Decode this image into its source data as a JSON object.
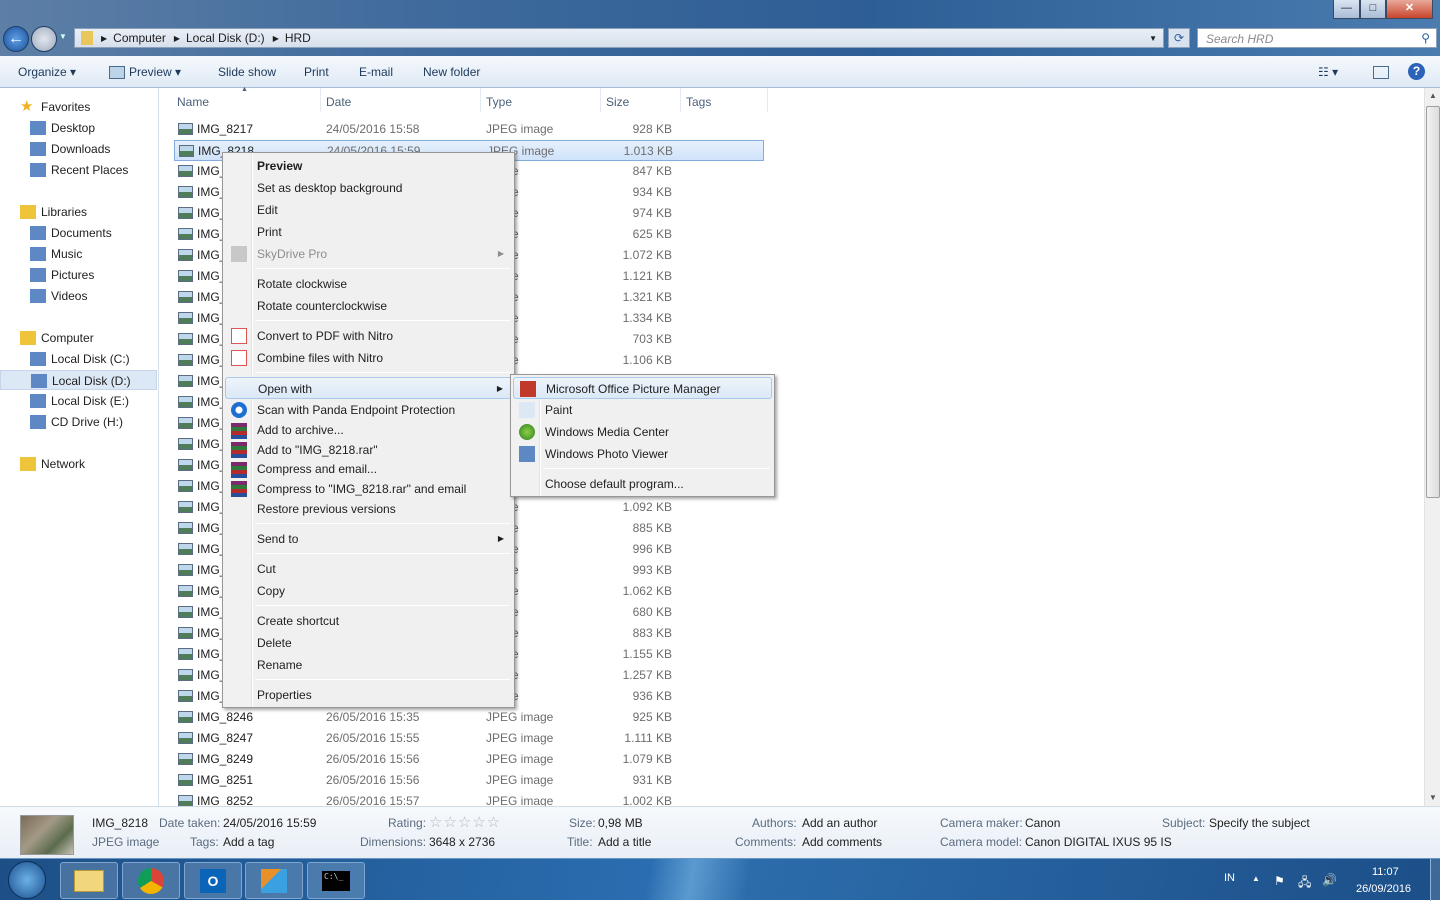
{
  "window": {
    "minimize": "—",
    "maximize": "□",
    "close": "✕"
  },
  "address": {
    "crumbs": [
      "Computer",
      "Local Disk (D:)",
      "HRD"
    ],
    "search_placeholder": "Search HRD"
  },
  "toolbar": {
    "organize": "Organize ▾",
    "preview": "Preview ▾",
    "slideshow": "Slide show",
    "print": "Print",
    "email": "E-mail",
    "new_folder": "New folder"
  },
  "sidebar": {
    "items": [
      {
        "label": "Favorites",
        "icon": "star-icon",
        "group": true
      },
      {
        "label": "Desktop",
        "icon": "desktop-icon"
      },
      {
        "label": "Downloads",
        "icon": "downloads-icon"
      },
      {
        "label": "Recent Places",
        "icon": "recent-places-icon"
      },
      {
        "label": "Libraries",
        "icon": "libraries-icon",
        "group": true
      },
      {
        "label": "Documents",
        "icon": "documents-icon"
      },
      {
        "label": "Music",
        "icon": "music-icon"
      },
      {
        "label": "Pictures",
        "icon": "pictures-icon"
      },
      {
        "label": "Videos",
        "icon": "videos-icon"
      },
      {
        "label": "Computer",
        "icon": "computer-icon",
        "group": true
      },
      {
        "label": "Local Disk (C:)",
        "icon": "drive-icon"
      },
      {
        "label": "Local Disk (D:)",
        "icon": "drive-icon",
        "selected": true
      },
      {
        "label": "Local Disk (E:)",
        "icon": "drive-icon"
      },
      {
        "label": "CD Drive (H:)",
        "icon": "cd-drive-icon"
      },
      {
        "label": "Network",
        "icon": "network-icon",
        "group": true
      }
    ]
  },
  "columns": [
    "Name",
    "Date",
    "Type",
    "Size",
    "Tags"
  ],
  "files": [
    {
      "name": "IMG_8217",
      "date": "24/05/2016 15:58",
      "type": "JPEG image",
      "size": "928 KB"
    },
    {
      "name": "IMG_8218",
      "date": "24/05/2016 15:59",
      "type": "JPEG image",
      "size": "1.013 KB",
      "selected": true
    },
    {
      "name": "IMG_",
      "type": "image",
      "size": "847 KB"
    },
    {
      "name": "IMG_",
      "type": "image",
      "size": "934 KB"
    },
    {
      "name": "IMG_",
      "type": "image",
      "size": "974 KB"
    },
    {
      "name": "IMG_",
      "type": "image",
      "size": "625 KB"
    },
    {
      "name": "IMG_",
      "type": "image",
      "size": "1.072 KB"
    },
    {
      "name": "IMG_",
      "type": "image",
      "size": "1.121 KB"
    },
    {
      "name": "IMG_",
      "type": "image",
      "size": "1.321 KB"
    },
    {
      "name": "IMG_",
      "type": "image",
      "size": "1.334 KB"
    },
    {
      "name": "IMG_",
      "type": "image",
      "size": "703 KB"
    },
    {
      "name": "IMG_",
      "type": "image",
      "size": "1.106 KB"
    },
    {
      "name": "IMG_"
    },
    {
      "name": "IMG_"
    },
    {
      "name": "IMG_"
    },
    {
      "name": "IMG_"
    },
    {
      "name": "IMG_"
    },
    {
      "name": "IMG_"
    },
    {
      "name": "IMG_",
      "type": "image",
      "size": "1.092 KB"
    },
    {
      "name": "IMG_",
      "type": "image",
      "size": "885 KB"
    },
    {
      "name": "IMG_",
      "type": "image",
      "size": "996 KB"
    },
    {
      "name": "IMG_",
      "type": "image",
      "size": "993 KB"
    },
    {
      "name": "IMG_",
      "type": "image",
      "size": "1.062 KB"
    },
    {
      "name": "IMG_",
      "type": "image",
      "size": "680 KB"
    },
    {
      "name": "IMG_",
      "type": "image",
      "size": "883 KB"
    },
    {
      "name": "IMG_",
      "type": "image",
      "size": "1.155 KB"
    },
    {
      "name": "IMG_",
      "type": "image",
      "size": "1.257 KB"
    },
    {
      "name": "IMG_",
      "type": "image",
      "size": "936 KB"
    },
    {
      "name": "IMG_8246",
      "date": "26/05/2016 15:35",
      "type": "JPEG image",
      "size": "925 KB"
    },
    {
      "name": "IMG_8247",
      "date": "26/05/2016 15:55",
      "type": "JPEG image",
      "size": "1.111 KB"
    },
    {
      "name": "IMG_8249",
      "date": "26/05/2016 15:56",
      "type": "JPEG image",
      "size": "1.079 KB"
    },
    {
      "name": "IMG_8251",
      "date": "26/05/2016 15:56",
      "type": "JPEG image",
      "size": "931 KB"
    },
    {
      "name": "IMG_8252",
      "date": "26/05/2016 15:57",
      "type": "JPEG image",
      "size": "1.002 KB"
    }
  ],
  "context_menu": [
    {
      "label": "Preview",
      "bold": true
    },
    {
      "label": "Set as desktop background"
    },
    {
      "label": "Edit"
    },
    {
      "label": "Print"
    },
    {
      "label": "SkyDrive Pro",
      "disabled": true,
      "submenu": true,
      "icon": "skydrive-icon"
    },
    {
      "sep": true
    },
    {
      "label": "Rotate clockwise"
    },
    {
      "label": "Rotate counterclockwise"
    },
    {
      "sep": true
    },
    {
      "label": "Convert to PDF with Nitro",
      "icon": "nitro-pdf-icon"
    },
    {
      "label": "Combine files with Nitro",
      "icon": "nitro-combine-icon"
    },
    {
      "sep": true
    },
    {
      "label": "Open with",
      "submenu": true,
      "highlighted": true
    },
    {
      "label": "Scan with Panda Endpoint Protection",
      "icon": "panda-icon"
    },
    {
      "label": "Add to archive...",
      "icon": "winrar-icon",
      "compact": true
    },
    {
      "label": "Add to \"IMG_8218.rar\"",
      "icon": "winrar-icon",
      "compact": true
    },
    {
      "label": "Compress and email...",
      "icon": "winrar-icon",
      "compact": true
    },
    {
      "label": "Compress to \"IMG_8218.rar\" and email",
      "icon": "winrar-icon",
      "compact": true
    },
    {
      "label": "Restore previous versions"
    },
    {
      "sep": true
    },
    {
      "label": "Send to",
      "submenu": true
    },
    {
      "sep": true
    },
    {
      "label": "Cut"
    },
    {
      "label": "Copy"
    },
    {
      "sep": true
    },
    {
      "label": "Create shortcut"
    },
    {
      "label": "Delete"
    },
    {
      "label": "Rename"
    },
    {
      "sep": true
    },
    {
      "label": "Properties"
    }
  ],
  "open_with_menu": [
    {
      "label": "Microsoft Office Picture Manager",
      "icon": "picture-manager-icon",
      "highlighted": true
    },
    {
      "label": "Paint",
      "icon": "paint-icon"
    },
    {
      "label": "Windows Media Center",
      "icon": "media-center-icon"
    },
    {
      "label": "Windows Photo Viewer",
      "icon": "photo-viewer-icon"
    },
    {
      "sep": true
    },
    {
      "label": "Choose default program..."
    }
  ],
  "details": {
    "name": "IMG_8218",
    "kind": "JPEG image",
    "date_taken_label": "Date taken:",
    "date_taken": "24/05/2016 15:59",
    "tags_label": "Tags:",
    "tags": "Add a tag",
    "rating_label": "Rating:",
    "rating": 0,
    "rating_stars": "☆☆☆☆☆",
    "dimensions_label": "Dimensions:",
    "dimensions": "3648 x 2736",
    "size_label": "Size:",
    "size": "0,98 MB",
    "title_label": "Title:",
    "title": "Add a title",
    "authors_label": "Authors:",
    "authors": "Add an author",
    "comments_label": "Comments:",
    "comments": "Add comments",
    "camera_maker_label": "Camera maker:",
    "camera_maker": "Canon",
    "camera_model_label": "Camera model:",
    "camera_model": "Canon DIGITAL IXUS 95 IS",
    "subject_label": "Subject:",
    "subject": "Specify the subject"
  },
  "taskbar": {
    "apps": [
      "explorer-icon",
      "chrome-icon",
      "outlook-icon",
      "remote-desktop-icon",
      "cmd-icon"
    ],
    "cmd_text": "C:\\_",
    "lang": "IN",
    "time": "11:07",
    "date": "26/09/2016"
  }
}
